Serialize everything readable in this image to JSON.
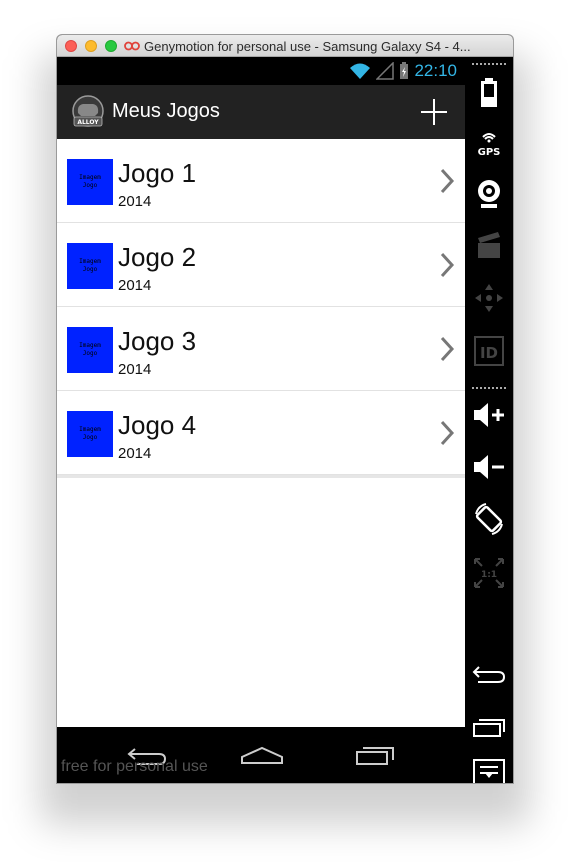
{
  "window": {
    "title": "Genymotion for personal use - Samsung Galaxy S4 - 4..."
  },
  "status_bar": {
    "time": "22:10"
  },
  "action_bar": {
    "logo_text": "ALLOY",
    "title": "Meus Jogos",
    "add_icon": "plus-icon"
  },
  "games": [
    {
      "thumb_line1": "Imagem",
      "thumb_line2": "Jogo",
      "title": "Jogo 1",
      "year": "2014"
    },
    {
      "thumb_line1": "Imagem",
      "thumb_line2": "Jogo",
      "title": "Jogo 2",
      "year": "2014"
    },
    {
      "thumb_line1": "Imagem",
      "thumb_line2": "Jogo",
      "title": "Jogo 3",
      "year": "2014"
    },
    {
      "thumb_line1": "Imagem",
      "thumb_line2": "Jogo",
      "title": "Jogo 4",
      "year": "2014"
    }
  ],
  "nav_bar": {
    "watermark": "free for personal use"
  },
  "sidebar": {
    "gps_label": "GPS",
    "id_label": "ID",
    "scale_label": "1:1"
  },
  "colors": {
    "clock": "#33b5e5",
    "thumbnail": "#0022ff",
    "action_bar": "#222222"
  }
}
